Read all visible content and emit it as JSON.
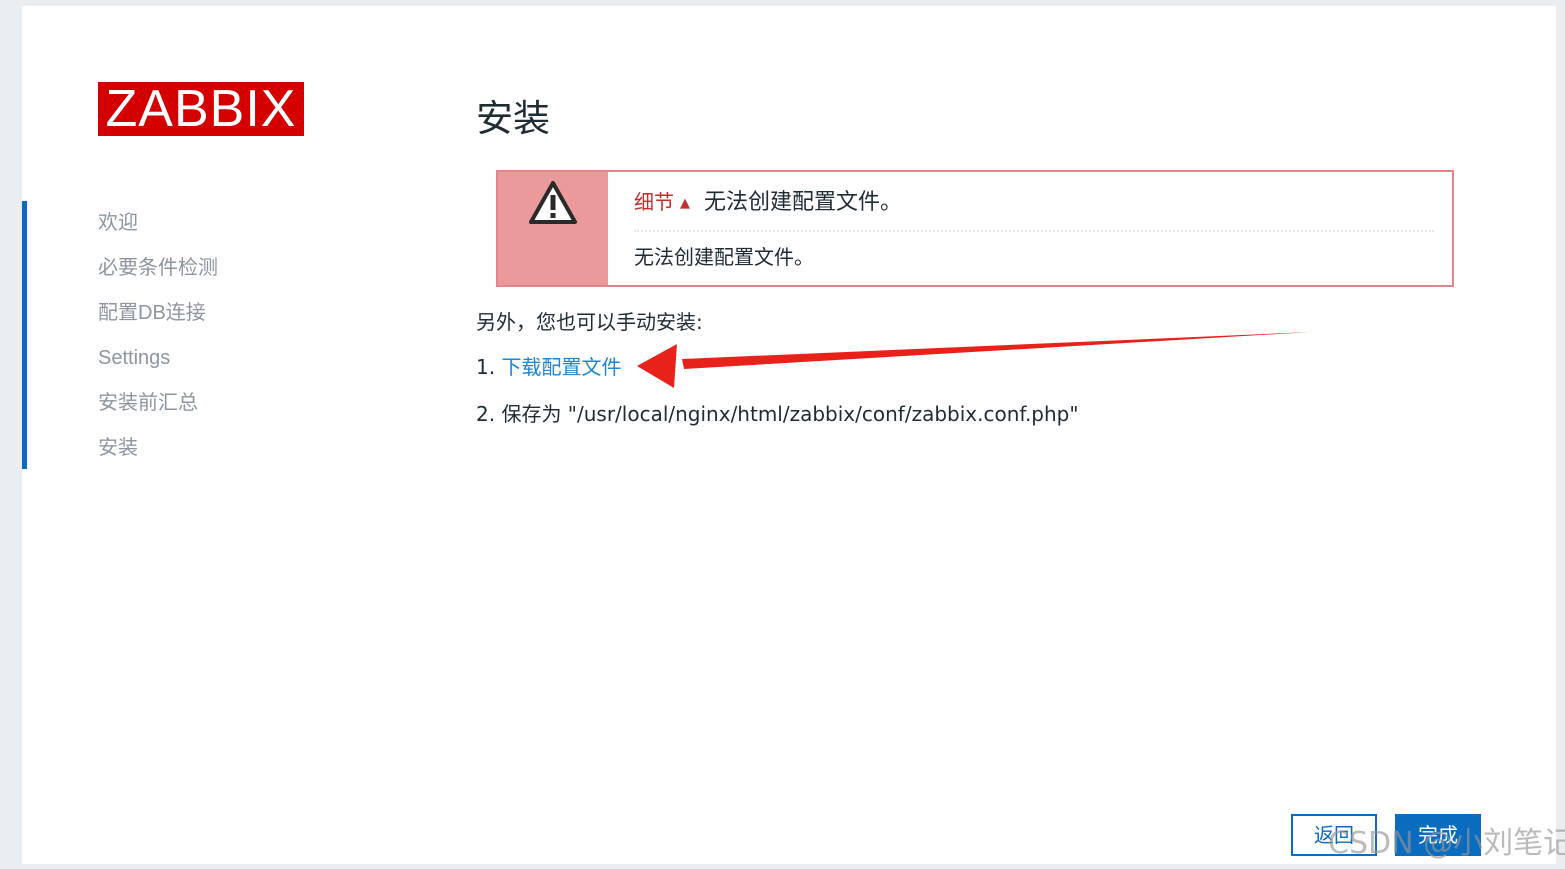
{
  "sidebar": {
    "logo_text": "ZABBIX",
    "items": [
      {
        "label": "欢迎"
      },
      {
        "label": "必要条件检测"
      },
      {
        "label": "配置DB连接"
      },
      {
        "label": "Settings"
      },
      {
        "label": "安装前汇总"
      },
      {
        "label": "安装"
      }
    ]
  },
  "main": {
    "title": "安装",
    "alert": {
      "details_label": "细节",
      "details_arrow": "▲",
      "message": "无法创建配置文件。",
      "detail_text": "无法创建配置文件。"
    },
    "manual_intro": "另外，您也可以手动安装:",
    "step1_number": "1.",
    "step1_link": "下载配置文件",
    "step2_text": "2. 保存为 \"/usr/local/nginx/html/zabbix/conf/zabbix.conf.php\""
  },
  "buttons": {
    "back": "返回",
    "finish": "完成"
  },
  "watermark": "CSDN @小刘笔记",
  "colors": {
    "brand_red": "#d40000",
    "accent_blue": "#0a6cbf",
    "link_blue": "#1e87cf",
    "error_border": "#e4848b",
    "error_bg": "#eb9a9c",
    "annotation_arrow": "#e8221b"
  },
  "icons": {
    "alert": "warning-icon",
    "annotation": "red-arrow-annotation"
  }
}
